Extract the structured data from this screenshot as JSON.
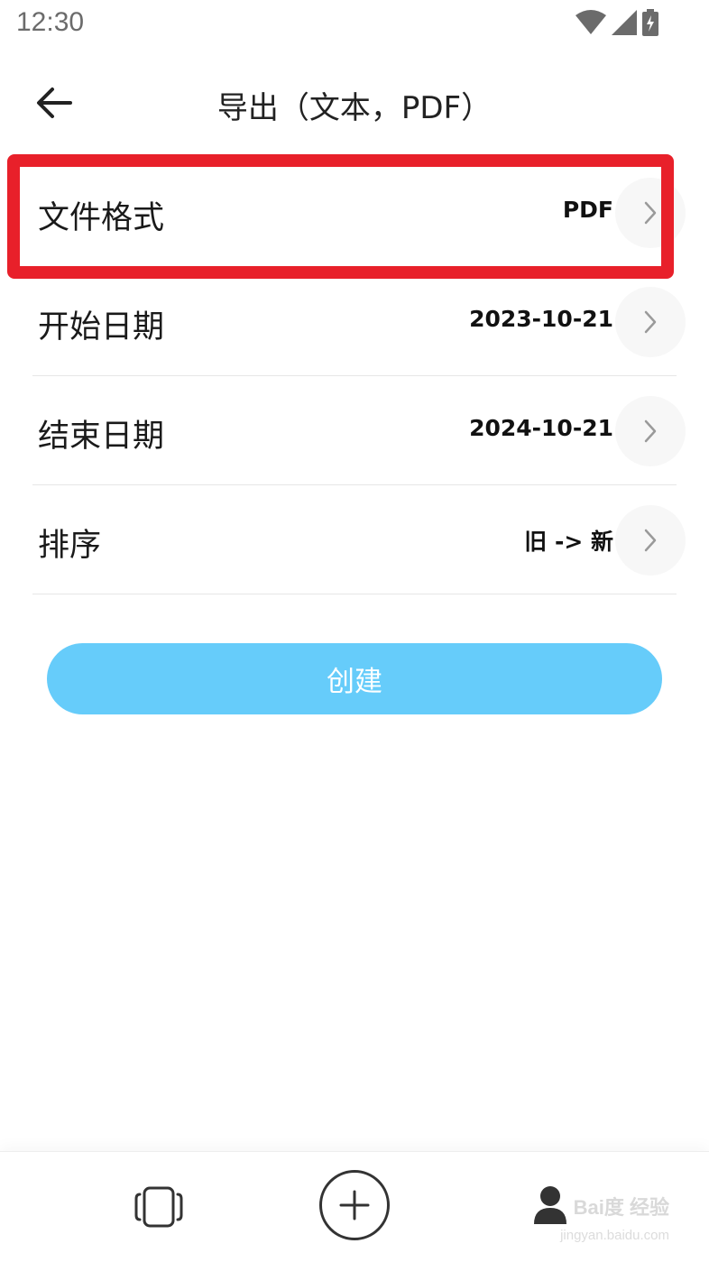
{
  "status_bar": {
    "time": "12:30",
    "icons": [
      "wifi-icon",
      "signal-icon",
      "battery-charging-icon"
    ]
  },
  "header": {
    "title": "导出（文本，PDF）",
    "back_icon": "arrow-left-icon"
  },
  "settings": {
    "rows": [
      {
        "label": "文件格式",
        "value": "PDF",
        "highlighted": true
      },
      {
        "label": "开始日期",
        "value": "2023-10-21"
      },
      {
        "label": "结束日期",
        "value": "2024-10-21"
      },
      {
        "label": "排序",
        "value": "旧 -> 新"
      }
    ],
    "highlight_color": "#e8202a"
  },
  "create_button": {
    "label": "创建",
    "color": "#66ccfa"
  },
  "bottom_nav": {
    "items": [
      {
        "icon": "carousel-icon"
      },
      {
        "icon": "add-icon"
      },
      {
        "icon": "user-icon"
      }
    ]
  },
  "watermark": {
    "text": "Bai度 经验",
    "sub": "jingyan.baidu.com"
  }
}
